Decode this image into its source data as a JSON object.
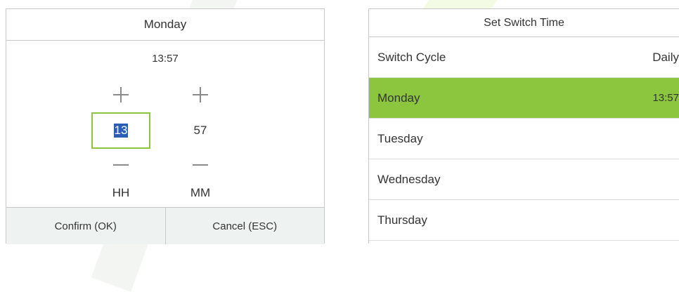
{
  "time_dialog": {
    "title": "Monday",
    "current_time": "13:57",
    "hour": {
      "value": "13",
      "unit": "HH"
    },
    "minute": {
      "value": "57",
      "unit": "MM"
    },
    "confirm_label": "Confirm (OK)",
    "cancel_label": "Cancel (ESC)"
  },
  "switch_time_panel": {
    "title": "Set Switch Time",
    "rows": [
      {
        "label": "Switch Cycle",
        "value": "Daily"
      },
      {
        "label": "Monday",
        "value": "13:57"
      },
      {
        "label": "Tuesday",
        "value": ""
      },
      {
        "label": "Wednesday",
        "value": ""
      },
      {
        "label": "Thursday",
        "value": ""
      }
    ]
  },
  "colors": {
    "accent_green": "#8cc63f",
    "selection_blue": "#2b5fb4",
    "button_bg": "#eef3f1"
  }
}
